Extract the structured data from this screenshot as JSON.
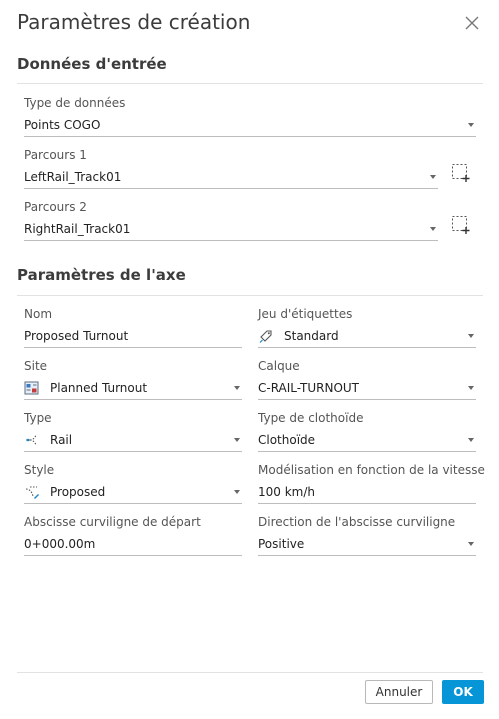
{
  "dialog": {
    "title": "Paramètres de création"
  },
  "input": {
    "heading": "Données d'entrée",
    "data_type": {
      "label": "Type de données",
      "value": "Points COGO"
    },
    "track1": {
      "label": "Parcours 1",
      "value": "LeftRail_Track01"
    },
    "track2": {
      "label": "Parcours 2",
      "value": "RightRail_Track01"
    }
  },
  "axis": {
    "heading": "Paramètres de l'axe",
    "name": {
      "label": "Nom",
      "value": "Proposed Turnout"
    },
    "label_set": {
      "label": "Jeu d'étiquettes",
      "value": "Standard",
      "icon": "label-tag-icon"
    },
    "site": {
      "label": "Site",
      "value": "Planned Turnout",
      "icon": "site-icon"
    },
    "layer": {
      "label": "Calque",
      "value": "C-RAIL-TURNOUT"
    },
    "type": {
      "label": "Type",
      "value": "Rail",
      "icon": "alignment-rail-icon"
    },
    "spiral_type": {
      "label": "Type de clothoïde",
      "value": "Clothoïde"
    },
    "style": {
      "label": "Style",
      "value": "Proposed",
      "icon": "alignment-style-icon"
    },
    "speed_modeling": {
      "label": "Modélisation en fonction de la vitesse",
      "value": "100 km/h"
    },
    "start_station": {
      "label": "Abscisse curviligne de départ",
      "value": "0+000.00m"
    },
    "station_direction": {
      "label": "Direction de l'abscisse curviligne",
      "value": "Positive"
    }
  },
  "footer": {
    "cancel": "Annuler",
    "ok": "OK"
  },
  "colors": {
    "accent": "#0696d7",
    "divider": "#e2e2e2"
  }
}
